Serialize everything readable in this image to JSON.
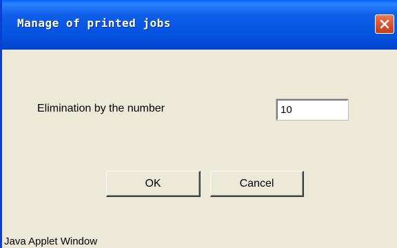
{
  "window": {
    "title": "Manage of printed jobs",
    "close_icon": "close-icon"
  },
  "form": {
    "label": "Elimination by the number",
    "value": "10"
  },
  "buttons": {
    "ok_label": "OK",
    "cancel_label": "Cancel"
  },
  "status": {
    "warning": "Java Applet Window"
  },
  "colors": {
    "titlebar": "#0553e0",
    "frame_border": "#0a3fd6",
    "client_background": "#ece9d8",
    "close_button": "#d9532f"
  }
}
